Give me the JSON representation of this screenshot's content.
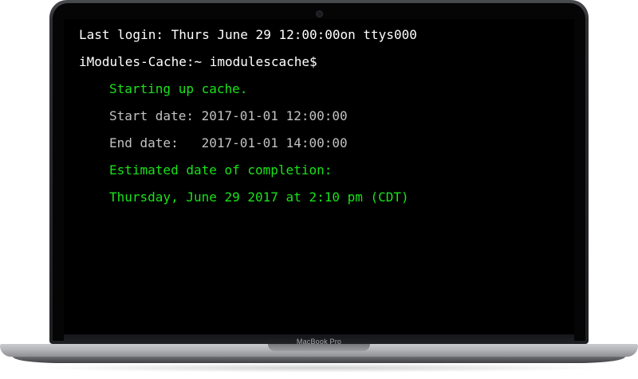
{
  "device": {
    "model_label": "MacBook Pro"
  },
  "terminal": {
    "last_login": "Last login: Thurs June 29 12:00:00on ttys000",
    "prompt": "iModules-Cache:~ imodulescache$",
    "output": [
      {
        "text": "Starting up cache.",
        "color": "#19e319"
      },
      {
        "text": "Start date: 2017-01-01 12:00:00",
        "color": "#c2c2c2"
      },
      {
        "text": "End date:   2017-01-01 14:00:00",
        "color": "#c2c2c2"
      },
      {
        "text": "Estimated date of completion:",
        "color": "#19e319"
      },
      {
        "text": "Thursday, June 29 2017 at 2:10 pm (CDT)",
        "color": "#19e319"
      }
    ]
  },
  "colors": {
    "screen_background": "#000000",
    "text_primary": "#ffffff",
    "text_success": "#19e319",
    "text_muted": "#c2c2c2"
  }
}
